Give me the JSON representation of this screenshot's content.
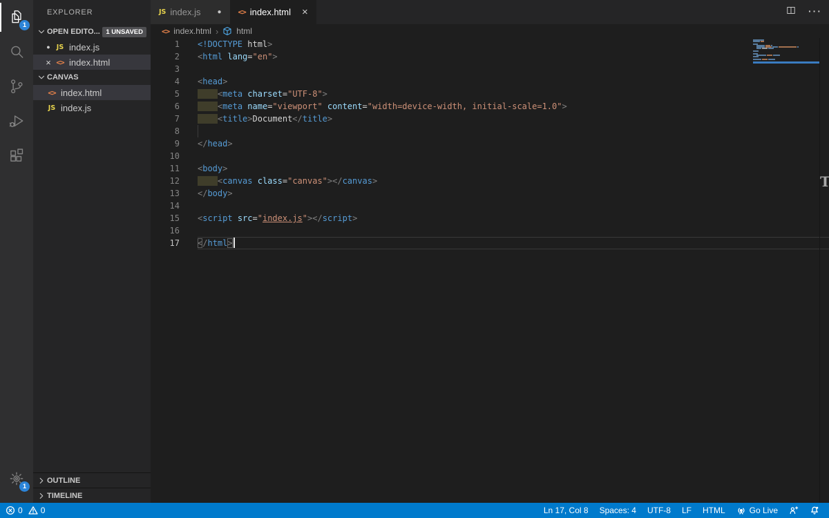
{
  "colors": {
    "accent": "#007acc",
    "activity_badge": "#2c84d8",
    "selected_row": "#37373d",
    "editor_bg": "#1e1e1e",
    "sidebar_bg": "#252526",
    "indent_highlight": "#3f3d2a",
    "minimap_current_line": "#3a7cc1"
  },
  "activity_bar": {
    "items": [
      {
        "name": "explorer",
        "badge": "1",
        "active": true
      },
      {
        "name": "search"
      },
      {
        "name": "source-control"
      },
      {
        "name": "run-debug"
      },
      {
        "name": "extensions"
      }
    ],
    "bottom": {
      "name": "settings",
      "badge": "1"
    }
  },
  "sidebar": {
    "title": "EXPLORER",
    "open_editors": {
      "label": "OPEN EDITO...",
      "badge": "1 UNSAVED",
      "items": [
        {
          "icon": "js",
          "label": "index.js",
          "modified": true,
          "selected": false
        },
        {
          "icon": "html",
          "label": "index.html",
          "close": true,
          "selected": true
        }
      ]
    },
    "folder": {
      "label": "CANVAS",
      "items": [
        {
          "icon": "html",
          "label": "index.html",
          "selected": true
        },
        {
          "icon": "js",
          "label": "index.js",
          "selected": false
        }
      ]
    },
    "bottom_sections": [
      "OUTLINE",
      "TIMELINE"
    ]
  },
  "tabs": [
    {
      "icon": "js",
      "label": "index.js",
      "modified": true,
      "active": false
    },
    {
      "icon": "html",
      "label": "index.html",
      "close": true,
      "active": true
    }
  ],
  "tab_actions": [
    "split-editor",
    "more-actions"
  ],
  "breadcrumb": {
    "file": "index.html",
    "symbol": "html",
    "separator": "›"
  },
  "editor": {
    "lines": [
      {
        "tokens": [
          [
            "t",
            "<!DOCTYPE"
          ],
          [
            "x",
            " html"
          ],
          [
            "p",
            ">"
          ]
        ]
      },
      {
        "tokens": [
          [
            "p",
            "<"
          ],
          [
            "t",
            "html"
          ],
          [
            "x",
            " "
          ],
          [
            "a",
            "lang"
          ],
          [
            "o",
            "="
          ],
          [
            "s",
            "\"en\""
          ],
          [
            "p",
            ">"
          ]
        ]
      },
      {
        "tokens": []
      },
      {
        "tokens": [
          [
            "p",
            "<"
          ],
          [
            "t",
            "head"
          ],
          [
            "p",
            ">"
          ]
        ]
      },
      {
        "tokens": [
          [
            "hl",
            "    "
          ],
          [
            "p",
            "<"
          ],
          [
            "t",
            "meta"
          ],
          [
            "x",
            " "
          ],
          [
            "a",
            "charset"
          ],
          [
            "o",
            "="
          ],
          [
            "s",
            "\"UTF-8\""
          ],
          [
            "p",
            ">"
          ]
        ]
      },
      {
        "tokens": [
          [
            "hl",
            "    "
          ],
          [
            "p",
            "<"
          ],
          [
            "t",
            "meta"
          ],
          [
            "x",
            " "
          ],
          [
            "a",
            "name"
          ],
          [
            "o",
            "="
          ],
          [
            "s",
            "\"viewport\""
          ],
          [
            "x",
            " "
          ],
          [
            "a",
            "content"
          ],
          [
            "o",
            "="
          ],
          [
            "s",
            "\"width=device-width, initial-scale=1.0\""
          ],
          [
            "p",
            ">"
          ]
        ]
      },
      {
        "tokens": [
          [
            "hl",
            "    "
          ],
          [
            "p",
            "<"
          ],
          [
            "t",
            "title"
          ],
          [
            "p",
            ">"
          ],
          [
            "x",
            "Document"
          ],
          [
            "p",
            "</"
          ],
          [
            "t",
            "title"
          ],
          [
            "p",
            ">"
          ]
        ]
      },
      {
        "tokens": [
          [
            "g",
            ""
          ]
        ]
      },
      {
        "tokens": [
          [
            "p",
            "</"
          ],
          [
            "t",
            "head"
          ],
          [
            "p",
            ">"
          ]
        ]
      },
      {
        "tokens": []
      },
      {
        "tokens": [
          [
            "p",
            "<"
          ],
          [
            "t",
            "body"
          ],
          [
            "p",
            ">"
          ]
        ]
      },
      {
        "tokens": [
          [
            "hl",
            "    "
          ],
          [
            "p",
            "<"
          ],
          [
            "t",
            "canvas"
          ],
          [
            "x",
            " "
          ],
          [
            "a",
            "class"
          ],
          [
            "o",
            "="
          ],
          [
            "s",
            "\"canvas\""
          ],
          [
            "p",
            ">"
          ],
          [
            "p",
            "</"
          ],
          [
            "t",
            "canvas"
          ],
          [
            "p",
            ">"
          ]
        ]
      },
      {
        "tokens": [
          [
            "p",
            "</"
          ],
          [
            "t",
            "body"
          ],
          [
            "p",
            ">"
          ]
        ]
      },
      {
        "tokens": []
      },
      {
        "tokens": [
          [
            "p",
            "<"
          ],
          [
            "t",
            "script"
          ],
          [
            "x",
            " "
          ],
          [
            "a",
            "src"
          ],
          [
            "o",
            "="
          ],
          [
            "s",
            "\""
          ],
          [
            "lk",
            "index.js"
          ],
          [
            "s",
            "\""
          ],
          [
            "p",
            ">"
          ],
          [
            "p",
            "</"
          ],
          [
            "t",
            "script"
          ],
          [
            "p",
            ">"
          ]
        ]
      },
      {
        "tokens": []
      },
      {
        "tokens": [
          [
            "pb",
            "<"
          ],
          [
            "p",
            "/"
          ],
          [
            "t",
            "html"
          ],
          [
            "pb",
            ">"
          ],
          [
            "cur",
            ""
          ]
        ],
        "current": true
      }
    ],
    "cursor": {
      "line": 17,
      "col": 8
    },
    "overlay_marker": "T",
    "minimap": [
      {
        "i": 0,
        "segs": [
          [
            "b",
            16
          ]
        ]
      },
      {
        "i": 0,
        "segs": [
          [
            "b",
            10
          ],
          [
            "o",
            5
          ]
        ]
      },
      {
        "i": 0,
        "segs": []
      },
      {
        "i": 0,
        "segs": [
          [
            "b",
            7
          ]
        ]
      },
      {
        "i": 5,
        "segs": [
          [
            "b",
            12
          ],
          [
            "o",
            7
          ],
          [
            "b",
            2
          ]
        ]
      },
      {
        "i": 5,
        "segs": [
          [
            "b",
            12
          ],
          [
            "o",
            9
          ],
          [
            "b",
            8
          ],
          [
            "o",
            26
          ],
          [
            "b",
            2
          ]
        ]
      },
      {
        "i": 5,
        "segs": [
          [
            "b",
            7
          ],
          [
            "w",
            8
          ],
          [
            "b",
            8
          ]
        ]
      },
      {
        "i": 0,
        "segs": []
      },
      {
        "i": 0,
        "segs": [
          [
            "b",
            8
          ]
        ]
      },
      {
        "i": 0,
        "segs": []
      },
      {
        "i": 0,
        "segs": [
          [
            "b",
            7
          ]
        ]
      },
      {
        "i": 5,
        "segs": [
          [
            "b",
            14
          ],
          [
            "o",
            8
          ],
          [
            "b",
            10
          ]
        ]
      },
      {
        "i": 0,
        "segs": [
          [
            "b",
            8
          ]
        ]
      },
      {
        "i": 0,
        "segs": []
      },
      {
        "i": 0,
        "segs": [
          [
            "b",
            12
          ],
          [
            "o",
            8
          ],
          [
            "b",
            10
          ]
        ]
      },
      {
        "i": 0,
        "segs": []
      },
      {
        "i": 0,
        "segs": [
          [
            "b",
            7
          ]
        ]
      }
    ]
  },
  "status_bar": {
    "errors": "0",
    "warnings": "0",
    "right_items": [
      {
        "id": "cursor-position",
        "label": "Ln 17, Col 8"
      },
      {
        "id": "indentation",
        "label": "Spaces: 4"
      },
      {
        "id": "encoding",
        "label": "UTF-8"
      },
      {
        "id": "eol",
        "label": "LF"
      },
      {
        "id": "language-mode",
        "label": "HTML"
      },
      {
        "id": "go-live",
        "label": "Go Live",
        "icon": "broadcast"
      },
      {
        "id": "feedback",
        "icon": "feedback"
      },
      {
        "id": "notifications",
        "icon": "bell-dot"
      }
    ]
  }
}
